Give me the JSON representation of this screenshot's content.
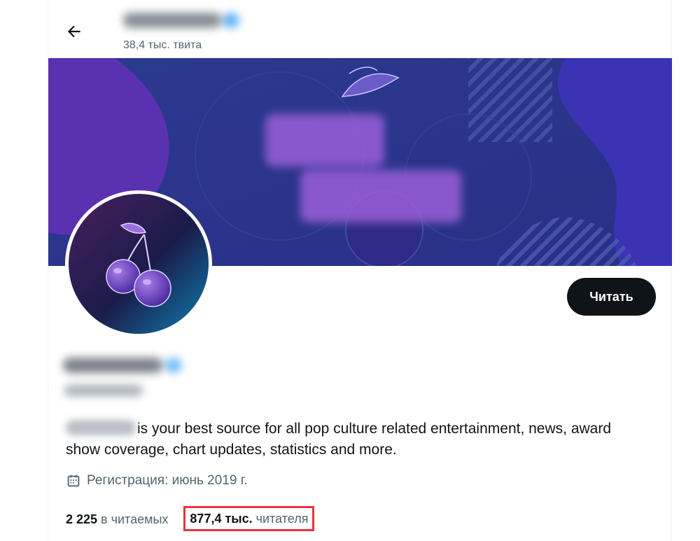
{
  "header": {
    "back_icon": "arrow-left-icon",
    "tweet_count": "38,4 тыс. твита"
  },
  "banner": {
    "colors": [
      "#3b2aa8",
      "#2a3590",
      "#6a37b8"
    ]
  },
  "profile": {
    "follow_button": "Читать",
    "bio_text": "is your best source for all pop culture related entertainment, news, award show coverage, chart updates, statistics and more.",
    "joined_icon": "calendar-icon",
    "joined_text": "Регистрация: июнь 2019 г.",
    "following_count": "2 225",
    "following_label": "в читаемых",
    "followers_count": "877,4 тыс.",
    "followers_label": "читателя"
  },
  "colors": {
    "accent_dark": "#0f1419",
    "secondary_text": "#536471",
    "highlight_border": "#e8323f",
    "verified_badge": "#5fb4f7"
  }
}
